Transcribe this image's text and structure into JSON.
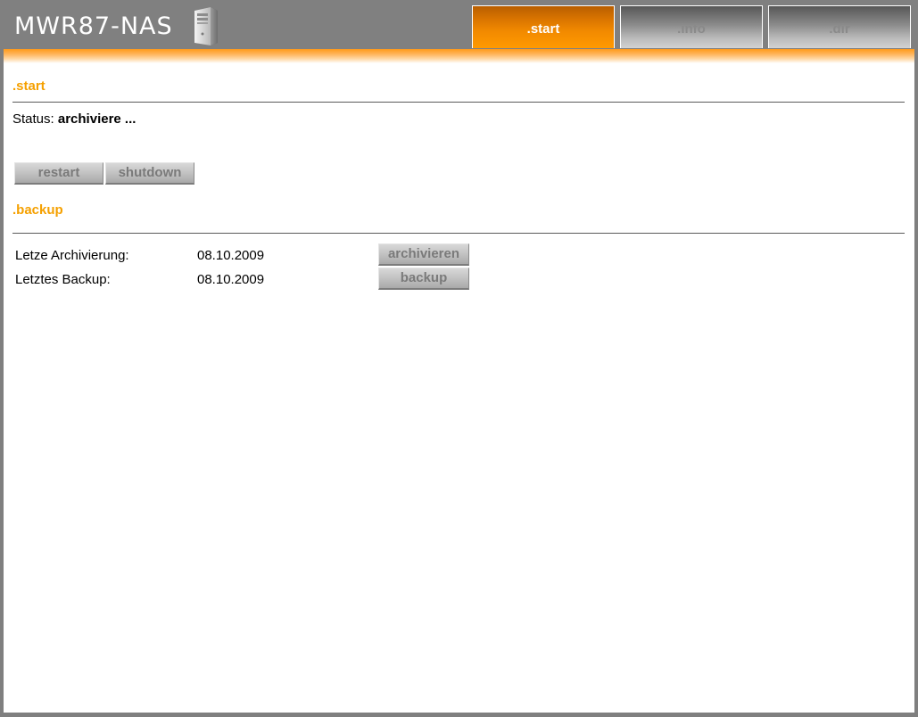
{
  "header": {
    "logo_text": "MWR87-NAS",
    "tabs": [
      {
        "label": ".start",
        "active": true
      },
      {
        "label": ".info",
        "active": false
      },
      {
        "label": ".dir",
        "active": false
      }
    ]
  },
  "start": {
    "title": ".start",
    "status_label": "Status:",
    "status_value": "archiviere ...",
    "restart_label": "restart",
    "shutdown_label": "shutdown"
  },
  "backup": {
    "title": ".backup",
    "rows": [
      {
        "label": "Letze Archivierung:",
        "date": "08.10.2009",
        "button": "archivieren"
      },
      {
        "label": "Letztes Backup:",
        "date": "08.10.2009",
        "button": "backup"
      }
    ]
  },
  "colors": {
    "accent": "#ff9900",
    "section_title": "#f5a000",
    "frame": "#7f7f7f"
  },
  "icons": {
    "server": "server-tower-icon"
  }
}
